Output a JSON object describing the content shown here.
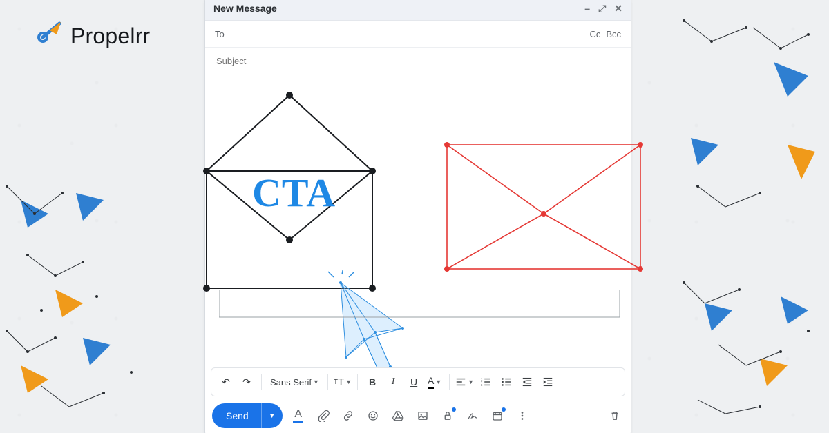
{
  "brand": {
    "name": "Propelrr"
  },
  "compose": {
    "title": "New Message",
    "to_label": "To",
    "subject_label": "Subject",
    "cc_label": "Cc",
    "bcc_label": "Bcc",
    "cta_text": "CTA",
    "font_name": "Sans Serif",
    "send_label": "Send"
  },
  "icons": {
    "minimize": "minimize-icon",
    "expand": "expand-icon",
    "close": "close-icon",
    "undo": "undo-icon",
    "redo": "redo-icon",
    "font_size": "font-size-icon",
    "bold": "bold-icon",
    "italic": "italic-icon",
    "underline": "underline-icon",
    "text_color": "text-color-icon",
    "align": "align-icon",
    "list_ordered": "numbered-list-icon",
    "list_bullet": "bullet-list-icon",
    "indent_less": "indent-decrease-icon",
    "indent_more": "indent-increase-icon",
    "format_options": "format-options-icon",
    "attach": "attach-icon",
    "link": "link-icon",
    "emoji": "emoji-icon",
    "drive": "drive-icon",
    "image": "image-icon",
    "confidential": "confidential-icon",
    "signature": "signature-icon",
    "schedule": "schedule-icon",
    "more": "more-options-icon",
    "trash": "trash-icon"
  },
  "colors": {
    "accent_blue": "#1a73e8",
    "cta_blue": "#1e88e5",
    "envelope_red": "#e53935",
    "brand_blue": "#2f7fd1",
    "brand_orange": "#f09a1a"
  }
}
